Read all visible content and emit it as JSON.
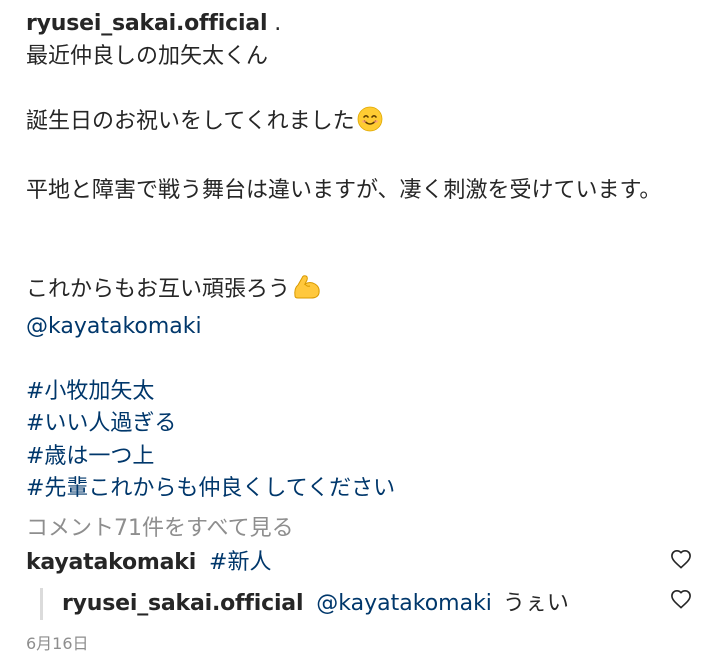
{
  "post": {
    "author": "ryusei_sakai.official",
    "author_suffix": " .",
    "lines": {
      "l1": "最近仲良しの加矢太くん",
      "l2": "誕生日のお祝いをしてくれました",
      "l3": "平地と障害で戦う舞台は違いますが、凄く刺激を受けています。",
      "l4": "これからもお互い頑張ろう",
      "mention": "@kayatakomaki"
    },
    "hashtags": [
      "#小牧加矢太",
      "#いい人過ぎる",
      "#歳は一つ上",
      "#先輩これからも仲良くしてください"
    ],
    "emojis": {
      "l2": "smiling-face-emoji",
      "l4": "flexed-biceps-emoji"
    }
  },
  "view_comments_label": "コメント71件をすべて見る",
  "comments": [
    {
      "author": "kayatakomaki",
      "text": "#新人"
    }
  ],
  "reply": {
    "author": "ryusei_sakai.official",
    "mention": "@kayatakomaki",
    "text": "うぇい"
  },
  "date": "6月16日",
  "colors": {
    "text": "#262626",
    "link": "#00376b",
    "muted": "#8e8e8e",
    "divider": "#dbdbdb"
  },
  "icons": {
    "like": "heart-outline-icon"
  }
}
